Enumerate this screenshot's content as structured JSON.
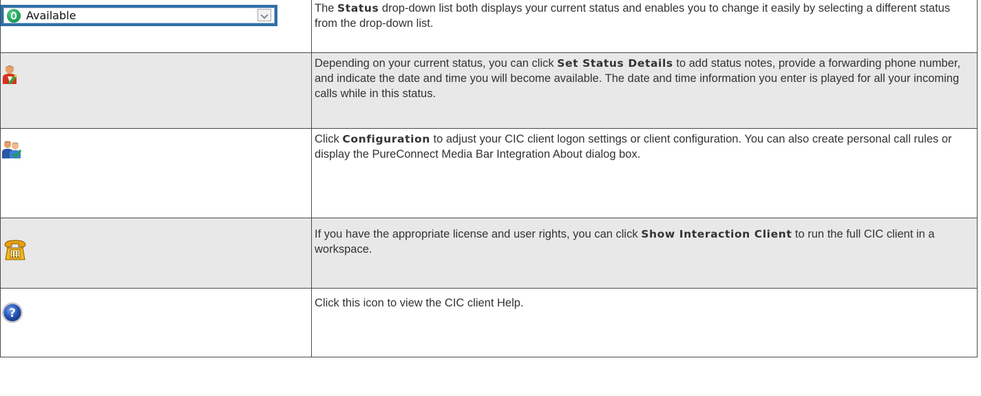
{
  "rows": [
    {
      "icon": "status-dropdown",
      "status_value": "Available",
      "parts": [
        "The ",
        "Status",
        " drop-down list both displays your current status and enables you to change it easily by selecting a different status from the drop-down list."
      ]
    },
    {
      "icon": "set-status-details-icon",
      "parts": [
        "Depending on your current status, you can click ",
        "Set Status Details",
        " to add status notes, provide a forwarding phone number, and indicate the date and time you will become available. The date and time information you enter is played for all your incoming calls while in this status."
      ]
    },
    {
      "icon": "configuration-icon",
      "parts": [
        "Click ",
        "Configuration",
        " to adjust your CIC client logon settings or client configuration. You can also create personal call rules or display the PureConnect Media Bar Integration About dialog box."
      ]
    },
    {
      "icon": "show-interaction-client-icon",
      "parts": [
        "If you have the appropriate license and user rights, you can click ",
        "Show Interaction Client",
        " to run the full CIC client in a workspace."
      ]
    },
    {
      "icon": "help-icon",
      "parts": [
        "Click this icon to view the CIC client Help."
      ]
    }
  ],
  "colors": {
    "row_shade": "#e8e8e8",
    "border": "#4a4a4a",
    "text": "#333333",
    "status_frame": "#2f6fa6",
    "status_dot": "#1f9e57"
  }
}
